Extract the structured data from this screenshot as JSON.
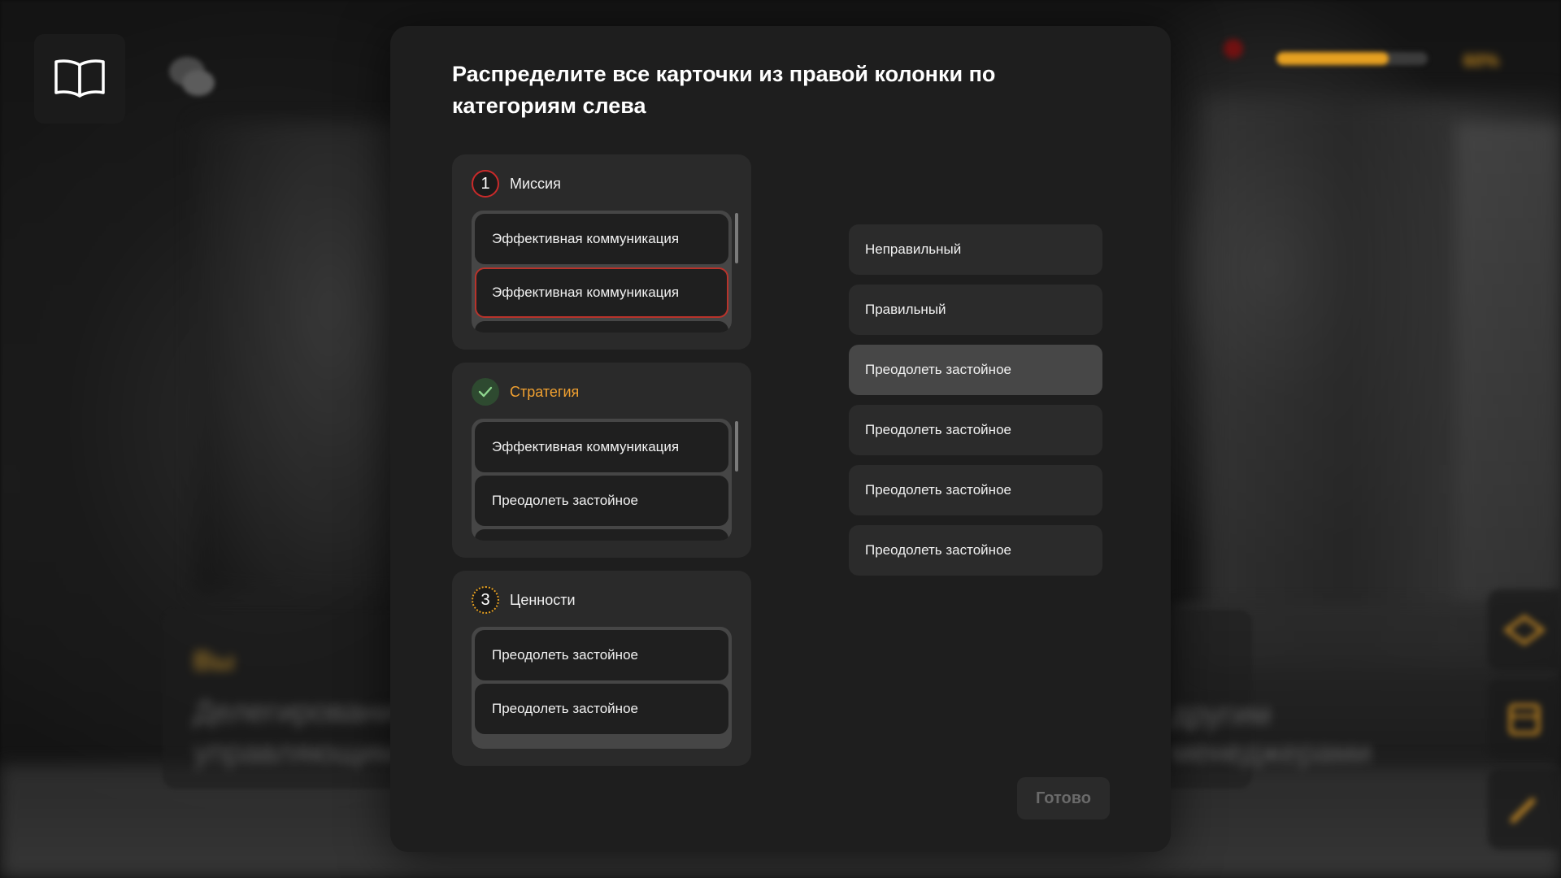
{
  "background": {
    "speaker": "Вы",
    "caption_lines": [
      "Делегирование",
      "управляющим"
    ],
    "caption_lines_right": [
      "другим",
      "менеджерами"
    ]
  },
  "hud": {
    "book_icon": "book-icon",
    "chat_icon": "chat-icon",
    "progress_percent": "60%",
    "progress_fraction": 0.74,
    "accent_color": "#e6a021",
    "tools": [
      "diamond-icon",
      "box-icon",
      "pencil-icon"
    ]
  },
  "modal": {
    "title": "Распределите все карточки из правой колонки по категориям слева",
    "categories": [
      {
        "badge": "1",
        "label": "Миссия",
        "state": "error",
        "items": [
          "Эффективная коммуникация",
          "Эффективная коммуникация"
        ]
      },
      {
        "badge": "✓",
        "label": "Стратегия",
        "state": "complete",
        "items": [
          "Эффективная коммуникация",
          "Преодолеть застойное"
        ]
      },
      {
        "badge": "3",
        "label": "Ценности",
        "state": "pending",
        "items": [
          "Преодолеть застойное",
          "Преодолеть застойное"
        ]
      }
    ],
    "cards": [
      "Неправильный",
      "Правильный",
      "Преодолеть застойное",
      "Преодолеть застойное",
      "Преодолеть застойное",
      "Преодолеть застойное"
    ],
    "selected_card_index": 2,
    "done_label": "Готово",
    "colors": {
      "error": "#b8332b",
      "success": "#2e4a30",
      "accent": "#f0a030"
    }
  }
}
